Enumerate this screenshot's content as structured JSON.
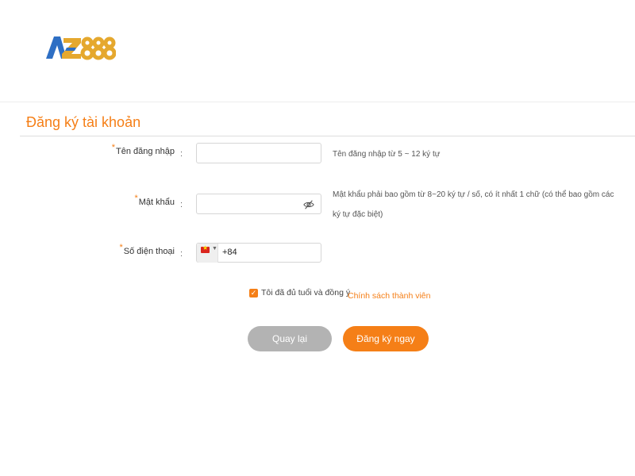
{
  "brand": {
    "logo_text": "AZ888",
    "colors": {
      "blue": "#2e6fc4",
      "gold": "#e5a82e",
      "accent": "#f57f17"
    }
  },
  "page": {
    "title": "Đăng ký tài khoản"
  },
  "form": {
    "username": {
      "label": "Tên đăng nhập",
      "required_mark": "*",
      "colon": ":",
      "value": "",
      "hint": "Tên đăng nhập từ 5 ~ 12 ký tự"
    },
    "password": {
      "label": "Mật khẩu",
      "required_mark": "*",
      "colon": ":",
      "value": "",
      "hint_line1": "Mật khẩu phải bao gồm từ 8~20 ký tự / số, có ít nhất 1 chữ (có thể bao gồm các",
      "hint_line2": "ký tự đặc biệt)",
      "toggle_icon": "eye-off-icon"
    },
    "phone": {
      "label": "Số điện thoại",
      "required_mark": "*",
      "colon": ":",
      "country_code": "+84",
      "flag": "vietnam-flag"
    }
  },
  "agreement": {
    "checked": true,
    "check_glyph": "✓",
    "text": "Tôi đã đủ tuổi và đồng ý",
    "link_text": "Chính sách thành viên"
  },
  "buttons": {
    "back": "Quay lại",
    "submit": "Đăng ký ngay"
  }
}
